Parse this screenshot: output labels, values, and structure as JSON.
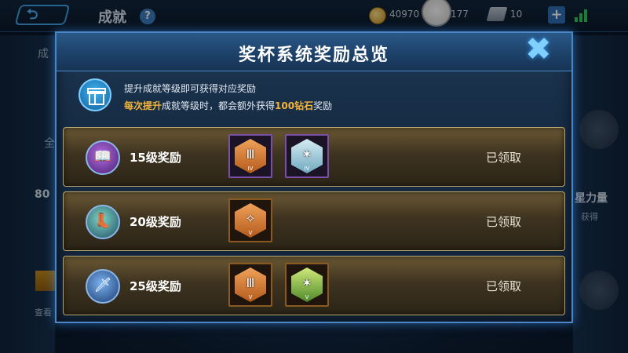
{
  "background": {
    "page_title": "成就",
    "help_label": "?",
    "gold_amount": "40970",
    "diamond_amount": "177",
    "coupon_amount": "10",
    "plus_label": "+",
    "side_left_1": "成",
    "side_left_2": "全",
    "side_left_3": "80",
    "side_right_1": "星力量",
    "side_right_2": "获得",
    "bottom_left": "查看"
  },
  "modal": {
    "title": "奖杯系统奖励总览",
    "close_label": "✖",
    "info_line1": "提升成就等级即可获得对应奖励",
    "info_line2_prefix": "每次提升",
    "info_line2_mid": "成就等级时，都会额外获得",
    "info_line2_amount": "100钻石",
    "info_line2_suffix": "奖励",
    "rows": [
      {
        "label": "15级奖励",
        "status": "已领取",
        "icon": "spellbook-icon",
        "badges": [
          {
            "name": "orange-gate-badge",
            "color": "#e08a3c",
            "tier": "IV",
            "symbol": "Ⅲ"
          },
          {
            "name": "blue-star-badge",
            "color": "#9fd3e6",
            "tier": "IV",
            "symbol": "✶"
          }
        ]
      },
      {
        "label": "20级奖励",
        "status": "已领取",
        "icon": "boots-icon",
        "badges": [
          {
            "name": "orange-wing-badge",
            "color": "#e08a3c",
            "tier": "V",
            "symbol": "✧"
          }
        ]
      },
      {
        "label": "25级奖励",
        "status": "已领取",
        "icon": "sword-icon",
        "badges": [
          {
            "name": "orange-gate-badge",
            "color": "#e08a3c",
            "tier": "V",
            "symbol": "Ⅲ"
          },
          {
            "name": "green-star-badge",
            "color": "#a8d65a",
            "tier": "V",
            "symbol": "✶"
          }
        ]
      }
    ]
  },
  "colors": {
    "accent_blue": "#4a87c7",
    "highlight_gold": "#f3b43a",
    "row_border": "#b9a46b"
  }
}
